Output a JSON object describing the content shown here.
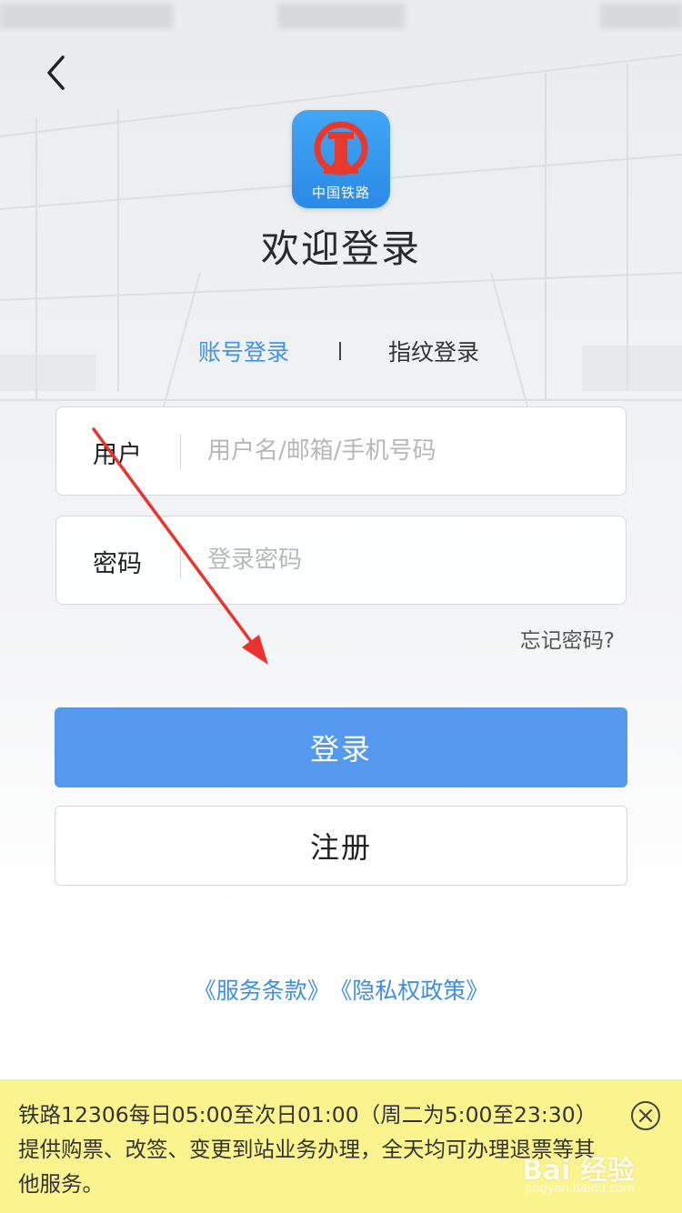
{
  "header": {
    "back_icon": "chevron-left-icon",
    "logo_text": "中国铁路",
    "welcome_title": "欢迎登录"
  },
  "tabs": [
    {
      "label": "账号登录",
      "active": true
    },
    {
      "label": "指纹登录",
      "active": false
    }
  ],
  "form": {
    "username": {
      "label": "用户",
      "placeholder": "用户名/邮箱/手机号码",
      "value": ""
    },
    "password": {
      "label": "密码",
      "placeholder": "登录密码",
      "value": ""
    },
    "forgot_label": "忘记密码?"
  },
  "buttons": {
    "login_label": "登录",
    "register_label": "注册"
  },
  "links": {
    "terms": "《服务条款》",
    "privacy": "《隐私权政策》"
  },
  "notice": {
    "text": "铁路12306每日05:00至次日01:00（周二为5:00至23:30）提供购票、改签、变更到站业务办理，全天均可办理退票等其他服务。",
    "close_icon": "close-circle-icon"
  },
  "watermark": {
    "brand": "Bai 经验",
    "sub": "jingyan.baidu.com"
  },
  "colors": {
    "accent": "#5599ee",
    "link": "#3f8ee6",
    "notice_bg": "#fbf48e",
    "annotation_arrow": "#e8332f"
  }
}
